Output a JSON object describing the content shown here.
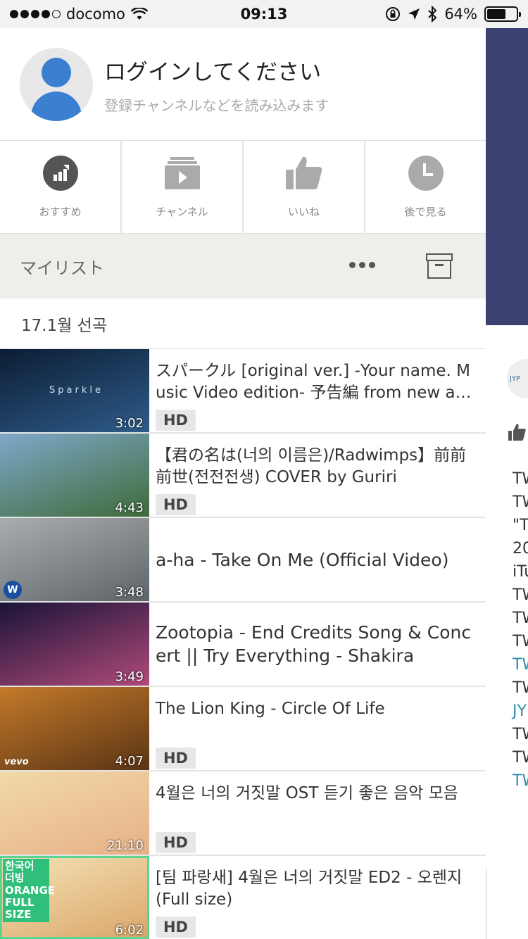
{
  "status_bar": {
    "carrier": "docomo",
    "time": "09:13",
    "battery_percent": "64%",
    "battery_level": 0.64,
    "icons": [
      "signal-dots",
      "wifi-icon",
      "orientation-lock-icon",
      "location-icon",
      "bluetooth-icon",
      "battery-icon"
    ]
  },
  "profile": {
    "title": "ログインしてください",
    "subtitle": "登録チャンネルなどを読み込みます"
  },
  "quick_nav": [
    {
      "label": "おすすめ",
      "icon": "recommend-icon"
    },
    {
      "label": "チャンネル",
      "icon": "channel-icon"
    },
    {
      "label": "いいね",
      "icon": "like-icon"
    },
    {
      "label": "後で見る",
      "icon": "watch-later-icon"
    }
  ],
  "mylist": {
    "title": "マイリスト",
    "more_icon": "more-icon",
    "archive_icon": "archive-icon"
  },
  "playlist_name": "17.1월 선곡",
  "videos": [
    {
      "title": "スパークル [original ver.] -Your name. Music Video edition- 予告編 from new a…",
      "duration": "3:02",
      "hd": "HD",
      "thumb_text": "Sparkle",
      "thumb_colors": [
        "#0b1d34",
        "#2f5c8a"
      ]
    },
    {
      "title": "【君の名は(너의 이름은)/Radwimps】前前前世(전전전생) COVER by Guriri",
      "duration": "4:43",
      "hd": "HD",
      "thumb_colors": [
        "#7fa8c9",
        "#3e6b3a"
      ]
    },
    {
      "title": "a-ha - Take On Me (Official Video)",
      "duration": "3:48",
      "hd": "",
      "badge": "W",
      "thumb_colors": [
        "#a9adb0",
        "#5e6468"
      ]
    },
    {
      "title": "Zootopia - End Credits Song & Concert || Try Everything - Shakira",
      "duration": "3:49",
      "hd": "",
      "thumb_colors": [
        "#1a1438",
        "#b04a7a"
      ]
    },
    {
      "title": "The Lion King - Circle Of Life",
      "duration": "4:07",
      "hd": "HD",
      "thumb_text": "vevo",
      "thumb_colors": [
        "#c47a2a",
        "#5a3414"
      ]
    },
    {
      "title": "4월은 너의 거짓말 OST 듣기 좋은 음악 모음",
      "duration": "21:10",
      "hd": "HD",
      "thumb_colors": [
        "#f1d9a8",
        "#e7b089"
      ]
    },
    {
      "title": "[팀 파랑새] 4월은 너의 거짓말 ED2 - 오렌지 (Full size)",
      "duration": "6:02",
      "hd": "HD",
      "badge_text": "한국어 더빙 ORANGE FULL SIZE",
      "thumb_colors": [
        "#f6e3b6",
        "#d9a66a"
      ]
    }
  ],
  "background_app": {
    "lines": [
      "TW",
      "TW",
      "\"T",
      "20",
      "iTu",
      "TW",
      "TW",
      "TW",
      "TW",
      "TW",
      "JY",
      "TW",
      "TW",
      "TW"
    ],
    "logo_text": "JYP"
  }
}
